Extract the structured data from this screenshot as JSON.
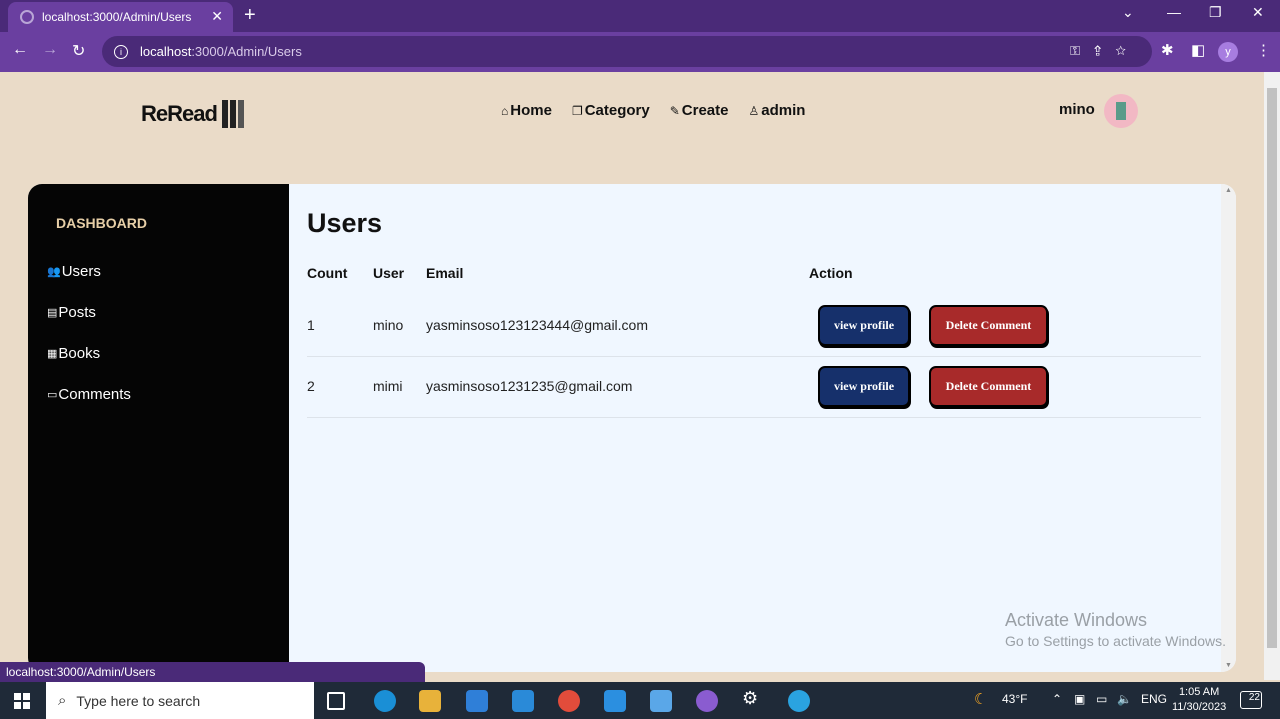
{
  "browser": {
    "tab_title": "localhost:3000/Admin/Users",
    "tab_close": "✕",
    "new_tab": "+",
    "url_host": "localhost",
    "url_path": ":3000/Admin/Users",
    "status_url": "localhost:3000/Admin/Users",
    "profile_initial": "y"
  },
  "site": {
    "logo_text": "ReRead",
    "nav": [
      {
        "icon": "⌂",
        "label": "Home"
      },
      {
        "icon": "❐",
        "label": "Category"
      },
      {
        "icon": "✎",
        "label": "Create"
      },
      {
        "icon": "♙",
        "label": "admin"
      }
    ],
    "username": "mino"
  },
  "sidebar": {
    "title": "DASHBOARD",
    "items": [
      {
        "icon": "👥",
        "label": "Users"
      },
      {
        "icon": "▤",
        "label": "Posts"
      },
      {
        "icon": "▦",
        "label": "Books"
      },
      {
        "icon": "▭",
        "label": "Comments"
      }
    ]
  },
  "main": {
    "title": "Users",
    "columns": [
      "Count",
      "User",
      "Email",
      "Action"
    ],
    "rows": [
      {
        "count": "1",
        "user": "mino",
        "email": "yasminsoso123123444@gmail.com",
        "view_label": "view profile",
        "delete_label": "Delete Comment"
      },
      {
        "count": "2",
        "user": "mimi",
        "email": "yasminsoso1231235@gmail.com",
        "view_label": "view profile",
        "delete_label": "Delete Comment"
      }
    ]
  },
  "watermark": {
    "line1": "Activate Windows",
    "line2": "Go to Settings to activate Windows."
  },
  "taskbar": {
    "search_placeholder": "Type here to search",
    "weather": "43°F",
    "language": "ENG",
    "time": "1:05 AM",
    "date": "11/30/2023",
    "notifications": "22"
  },
  "colors": {
    "browser_purple": "#6a3fa0",
    "page_bg": "#eadbc8",
    "sidebar_bg": "#050505",
    "view_button": "#16306b",
    "delete_button": "#a82a2a"
  }
}
